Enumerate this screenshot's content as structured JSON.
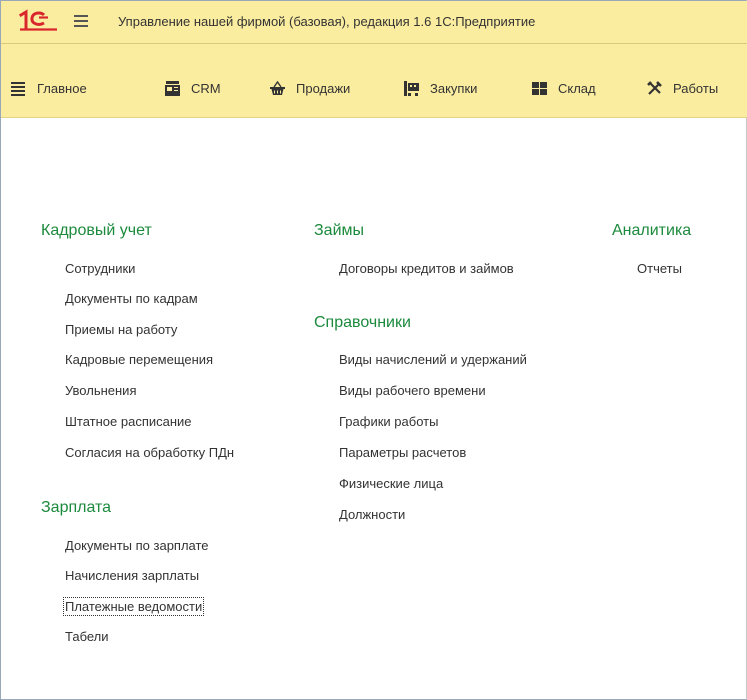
{
  "window": {
    "title": "Управление нашей фирмой (базовая), редакция 1.6 1С:Предприятие"
  },
  "sections": [
    {
      "label": "Главное",
      "icon": "list-icon"
    },
    {
      "label": "CRM",
      "icon": "crm-icon"
    },
    {
      "label": "Продажи",
      "icon": "basket-icon"
    },
    {
      "label": "Закупки",
      "icon": "cart-icon"
    },
    {
      "label": "Склад",
      "icon": "warehouse-icon"
    },
    {
      "label": "Работы",
      "icon": "tools-icon"
    }
  ],
  "groups": {
    "hr": {
      "title": "Кадровый учет",
      "items": [
        "Сотрудники",
        "Документы по кадрам",
        "Приемы на работу",
        "Кадровые перемещения",
        "Увольнения",
        "Штатное расписание",
        "Согласия на обработку ПДн"
      ]
    },
    "salary": {
      "title": "Зарплата",
      "items": [
        "Документы по зарплате",
        "Начисления зарплаты",
        "Платежные ведомости",
        "Табели"
      ]
    },
    "loans": {
      "title": "Займы",
      "items": [
        "Договоры кредитов и займов"
      ]
    },
    "catalogs": {
      "title": "Справочники",
      "items": [
        "Виды начислений и удержаний",
        "Виды рабочего времени",
        "Графики работы",
        "Параметры расчетов",
        "Физические лица",
        "Должности"
      ]
    },
    "analytics": {
      "title": "Аналитика",
      "items": [
        "Отчеты"
      ]
    }
  },
  "colors": {
    "panel_bg": "#fbeda0",
    "group_title": "#1c8a3d",
    "logo_red": "#d9262c"
  }
}
